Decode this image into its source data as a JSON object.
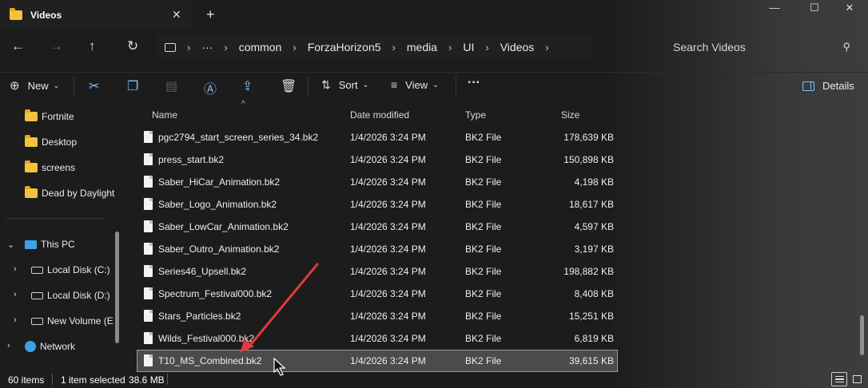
{
  "window": {
    "tab_title": "Videos",
    "close_tab": "✕",
    "new_tab": "+",
    "minimize": "—",
    "maximize": "☐",
    "close": "✕"
  },
  "nav": {
    "back": "←",
    "forward": "→",
    "up": "↑",
    "refresh": "↻"
  },
  "address": {
    "more": "···",
    "crumbs": [
      "common",
      "ForzaHorizon5",
      "media",
      "UI",
      "Videos"
    ]
  },
  "search": {
    "placeholder": "Search Videos"
  },
  "commands": {
    "new_label": "New",
    "sort_label": "Sort",
    "view_label": "View",
    "more": "···",
    "details_label": "Details"
  },
  "sidebar": {
    "quick": [
      {
        "label": "Fortnite"
      },
      {
        "label": "Desktop"
      },
      {
        "label": "screens"
      },
      {
        "label": "Dead by Daylight"
      }
    ],
    "this_pc": "This PC",
    "drives": [
      {
        "label": "Local Disk (C:)"
      },
      {
        "label": "Local Disk (D:)"
      },
      {
        "label": "New Volume (E"
      }
    ],
    "network": "Network"
  },
  "columns": {
    "name": "Name",
    "date": "Date modified",
    "type": "Type",
    "size": "Size"
  },
  "files": [
    {
      "name": "pgc2794_start_screen_series_34.bk2",
      "date": "1/4/2026 3:24 PM",
      "type": "BK2 File",
      "size": "178,639 KB"
    },
    {
      "name": "press_start.bk2",
      "date": "1/4/2026 3:24 PM",
      "type": "BK2 File",
      "size": "150,898 KB"
    },
    {
      "name": "Saber_HiCar_Animation.bk2",
      "date": "1/4/2026 3:24 PM",
      "type": "BK2 File",
      "size": "4,198 KB"
    },
    {
      "name": "Saber_Logo_Animation.bk2",
      "date": "1/4/2026 3:24 PM",
      "type": "BK2 File",
      "size": "18,617 KB"
    },
    {
      "name": "Saber_LowCar_Animation.bk2",
      "date": "1/4/2026 3:24 PM",
      "type": "BK2 File",
      "size": "4,597 KB"
    },
    {
      "name": "Saber_Outro_Animation.bk2",
      "date": "1/4/2026 3:24 PM",
      "type": "BK2 File",
      "size": "3,197 KB"
    },
    {
      "name": "Series46_Upsell.bk2",
      "date": "1/4/2026 3:24 PM",
      "type": "BK2 File",
      "size": "198,882 KB"
    },
    {
      "name": "Spectrum_Festival000.bk2",
      "date": "1/4/2026 3:24 PM",
      "type": "BK2 File",
      "size": "8,408 KB"
    },
    {
      "name": "Stars_Particles.bk2",
      "date": "1/4/2026 3:24 PM",
      "type": "BK2 File",
      "size": "15,251 KB"
    },
    {
      "name": "Wilds_Festival000.bk2",
      "date": "1/4/2026 3:24 PM",
      "type": "BK2 File",
      "size": "6,819 KB"
    },
    {
      "name": "T10_MS_Combined.bk2",
      "date": "1/4/2026 3:24 PM",
      "type": "BK2 File",
      "size": "39,615 KB",
      "selected": true
    }
  ],
  "status": {
    "items": "60 items",
    "selected": "1 item selected",
    "size": "38.6 MB"
  },
  "colors": {
    "background": "#1c1c1c",
    "selection": "#4b4b4b",
    "folder": "#f3c43b",
    "accent": "#3fa0e6",
    "annotation_arrow": "#e03a3a"
  }
}
